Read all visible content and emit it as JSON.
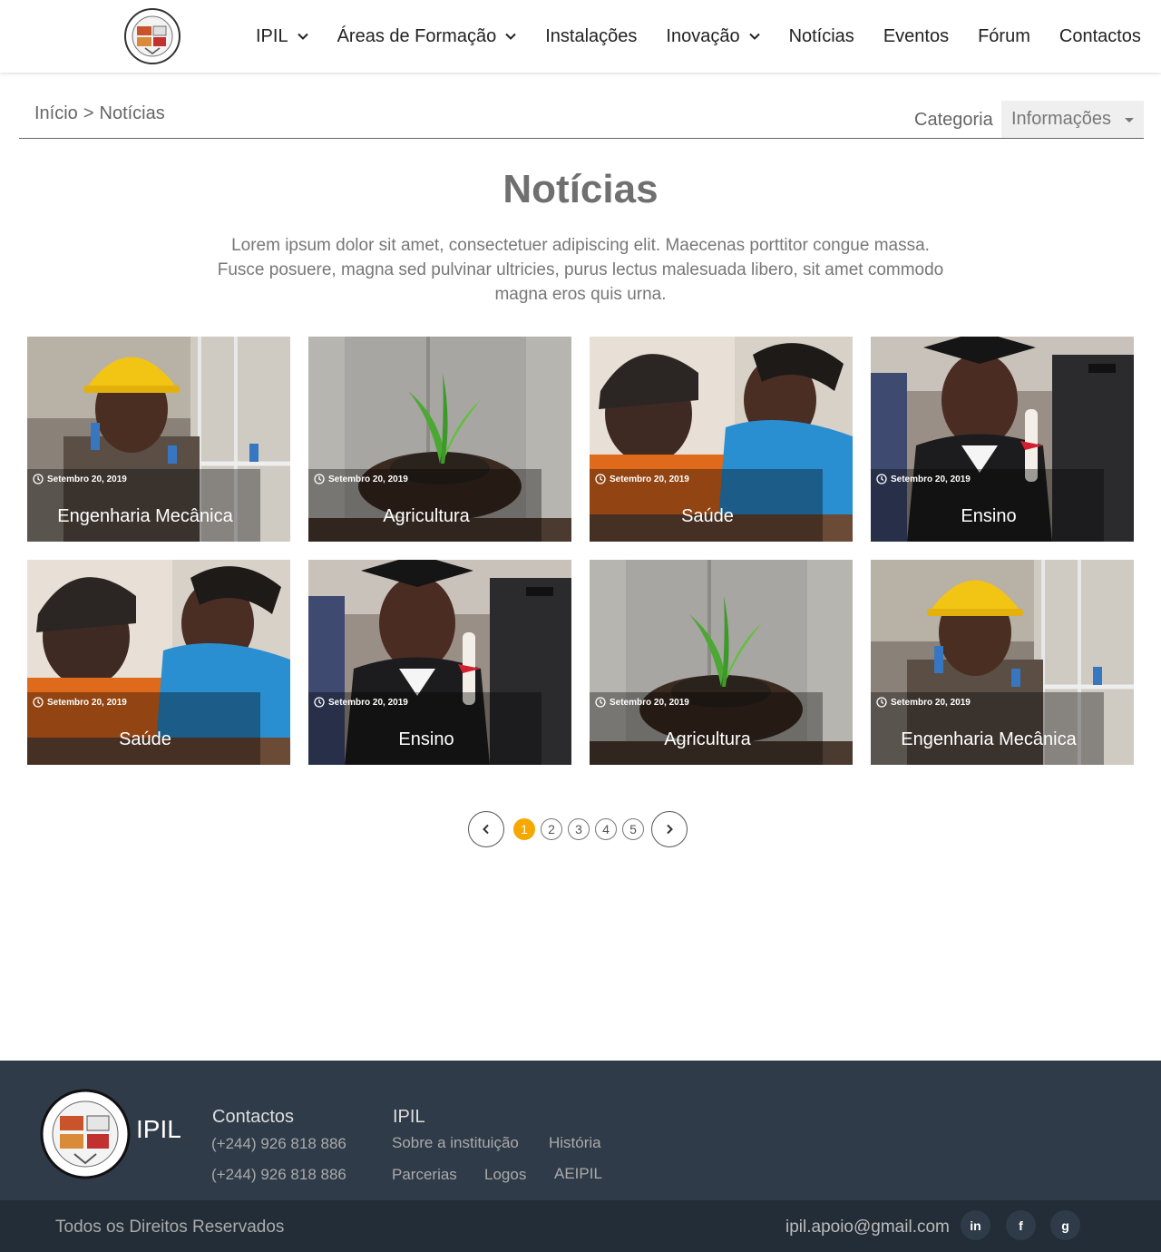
{
  "header": {
    "nav": [
      {
        "label": "IPIL",
        "dropdown": true
      },
      {
        "label": "Áreas de Formação",
        "dropdown": true
      },
      {
        "label": "Instalações",
        "dropdown": false
      },
      {
        "label": "Inovação",
        "dropdown": true
      },
      {
        "label": "Notícias",
        "dropdown": false
      },
      {
        "label": "Eventos",
        "dropdown": false
      },
      {
        "label": "Fórum",
        "dropdown": false
      },
      {
        "label": "Contactos",
        "dropdown": false
      }
    ]
  },
  "breadcrumb": {
    "home": "Início",
    "separator": ">",
    "current": "Notícias"
  },
  "category": {
    "label": "Categoria",
    "selected": "Informações"
  },
  "page": {
    "title": "Notícias",
    "intro": "Lorem ipsum dolor sit amet, consectetuer adipiscing elit. Maecenas porttitor congue massa. Fusce posuere, magna sed pulvinar ultricies, purus lectus malesuada libero, sit amet commodo magna eros quis urna."
  },
  "cards": [
    {
      "title": "Engenharia Mecânica",
      "date": "Setembro 20, 2019",
      "image": "engineer-photo"
    },
    {
      "title": "Agricultura",
      "date": "Setembro 20, 2019",
      "image": "plant-photo"
    },
    {
      "title": "Saúde",
      "date": "Setembro 20, 2019",
      "image": "nurse-photo"
    },
    {
      "title": "Ensino",
      "date": "Setembro 20, 2019",
      "image": "graduate-photo"
    },
    {
      "title": "Saúde",
      "date": "Setembro 20, 2019",
      "image": "nurse-photo"
    },
    {
      "title": "Ensino",
      "date": "Setembro 20, 2019",
      "image": "graduate-photo"
    },
    {
      "title": "Agricultura",
      "date": "Setembro 20, 2019",
      "image": "plant-photo"
    },
    {
      "title": "Engenharia Mecânica",
      "date": "Setembro 20, 2019",
      "image": "engineer-photo"
    }
  ],
  "pagination": {
    "pages": [
      "1",
      "2",
      "3",
      "4",
      "5"
    ],
    "current": "1",
    "active_color": "#f5a800"
  },
  "footer": {
    "brand": "IPIL",
    "contacts": {
      "title": "Contactos",
      "phones": [
        "(+244) 926 818 886",
        "(+244) 926 818 886"
      ]
    },
    "ipil": {
      "title": "IPIL",
      "links": [
        "Sobre a instituição",
        "História",
        "Parcerias",
        "Logos",
        "AEIPIL"
      ]
    },
    "rights": "Todos os Direitos Reservados",
    "email": "ipil.apoio@gmail.com",
    "social": [
      {
        "icon": "linkedin-icon",
        "glyph": "in"
      },
      {
        "icon": "facebook-icon",
        "glyph": "f"
      },
      {
        "icon": "google-icon",
        "glyph": "g"
      }
    ],
    "bg_color": "#2f3b48",
    "bottom_bg_color": "#232d37"
  }
}
